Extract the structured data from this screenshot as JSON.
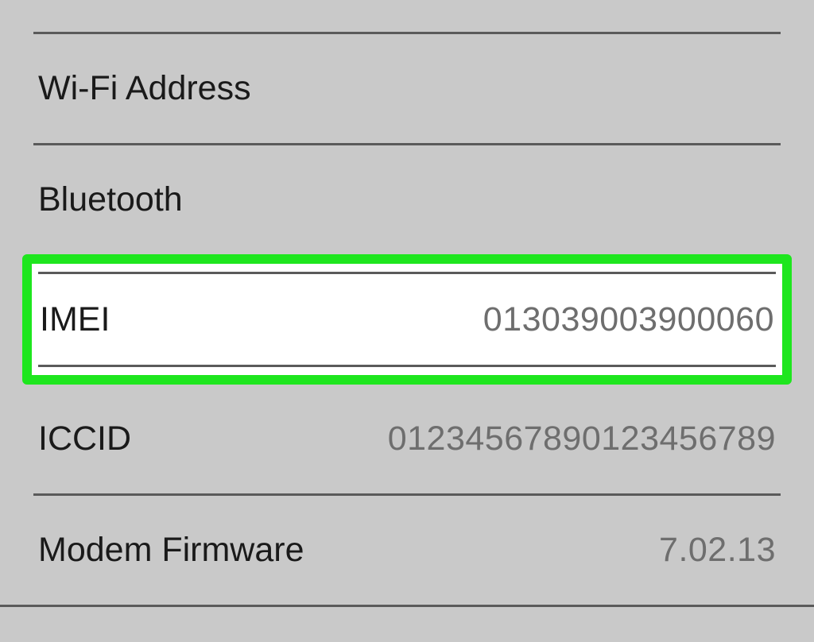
{
  "rows": {
    "wifi": {
      "label": "Wi-Fi Address",
      "value": ""
    },
    "bluetooth": {
      "label": "Bluetooth",
      "value": ""
    },
    "imei": {
      "label": "IMEI",
      "value": "013039003900060"
    },
    "iccid": {
      "label": "ICCID",
      "value": "01234567890123456789"
    },
    "modem": {
      "label": "Modem Firmware",
      "value": "7.02.13"
    }
  }
}
